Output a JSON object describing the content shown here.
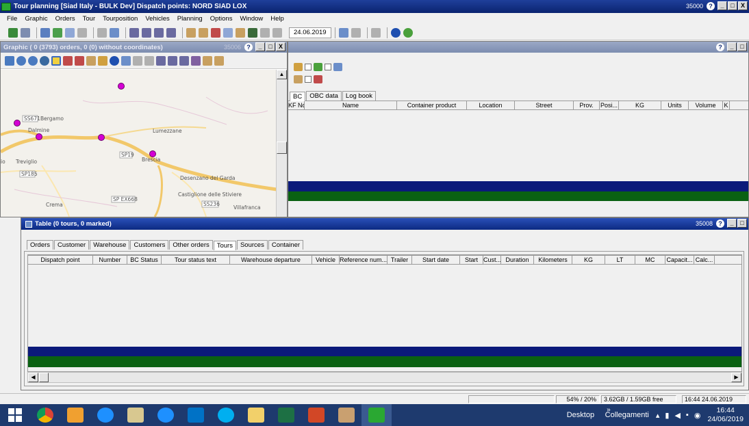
{
  "window": {
    "title": "Tour planning [Siad Italy - BULK Dev] Dispatch points: NORD SIAD LOX",
    "number": "35000",
    "help": "?",
    "min": "_",
    "max": "□",
    "close": "X"
  },
  "menu": [
    "File",
    "Graphic",
    "Orders",
    "Tour",
    "Tourposition",
    "Vehicles",
    "Planning",
    "Options",
    "Window",
    "Help"
  ],
  "toolbar": {
    "date": "24.06.2019"
  },
  "graphic_window": {
    "title": "Graphic ( 0 (3793) orders, 0 (0) without coordinates)",
    "number": "35006",
    "map_labels": {
      "ss671": "SS671",
      "bergamo": "Bergamo",
      "dalmine": "Dalmine",
      "lumezzane": "Lumezzane",
      "sp19": "SP19",
      "brescia": "Brescia",
      "treviglio": "Treviglio",
      "io": "io",
      "sp185": "SP185",
      "desenzano": "Desenzano del Garda",
      "castiglione": "Castiglione delle Stiviere",
      "spex668": "SP EX668",
      "ss236": "SS236",
      "crema": "Crema",
      "villafranca": "Villafranca"
    }
  },
  "detail_window": {
    "tabs": [
      "BC",
      "OBC data",
      "Log book"
    ],
    "columns": [
      "KF No.",
      "Name",
      "Container product",
      "Location",
      "Street",
      "Prov.",
      "Posi...",
      "KG",
      "Units",
      "Volume",
      "K"
    ]
  },
  "table_window": {
    "title": "Table (0 tours, 0 marked)",
    "number": "35008",
    "tabs": [
      "Orders",
      "Customer",
      "Warehouse",
      "Customers",
      "Other orders",
      "Tours",
      "Sources",
      "Container"
    ],
    "selected_tab": "Tours",
    "columns": [
      "Dispatch point",
      "Number",
      "BC Status",
      "Tour status text",
      "Warehouse departure",
      "Vehicle",
      "Reference num...",
      "Trailer",
      "Start date",
      "Start",
      "Cust...",
      "Duration",
      "Kilometers",
      "KG",
      "LT",
      "MC",
      "Capacit...",
      "Calc..."
    ]
  },
  "status": {
    "percent": "54% / 20%",
    "memory": "3.62GB / 1.59GB free",
    "datetime": "16:44  24.06.2019"
  },
  "taskbar": {
    "desktop": "Desktop",
    "links": "Collegamenti",
    "chevron": "»",
    "time": "16:44",
    "date": "24/06/2019"
  },
  "colors": {
    "title": "#0a2470",
    "band_blue": "#0b1a7a",
    "band_green": "#0a6112",
    "marker": "#d400d4"
  }
}
